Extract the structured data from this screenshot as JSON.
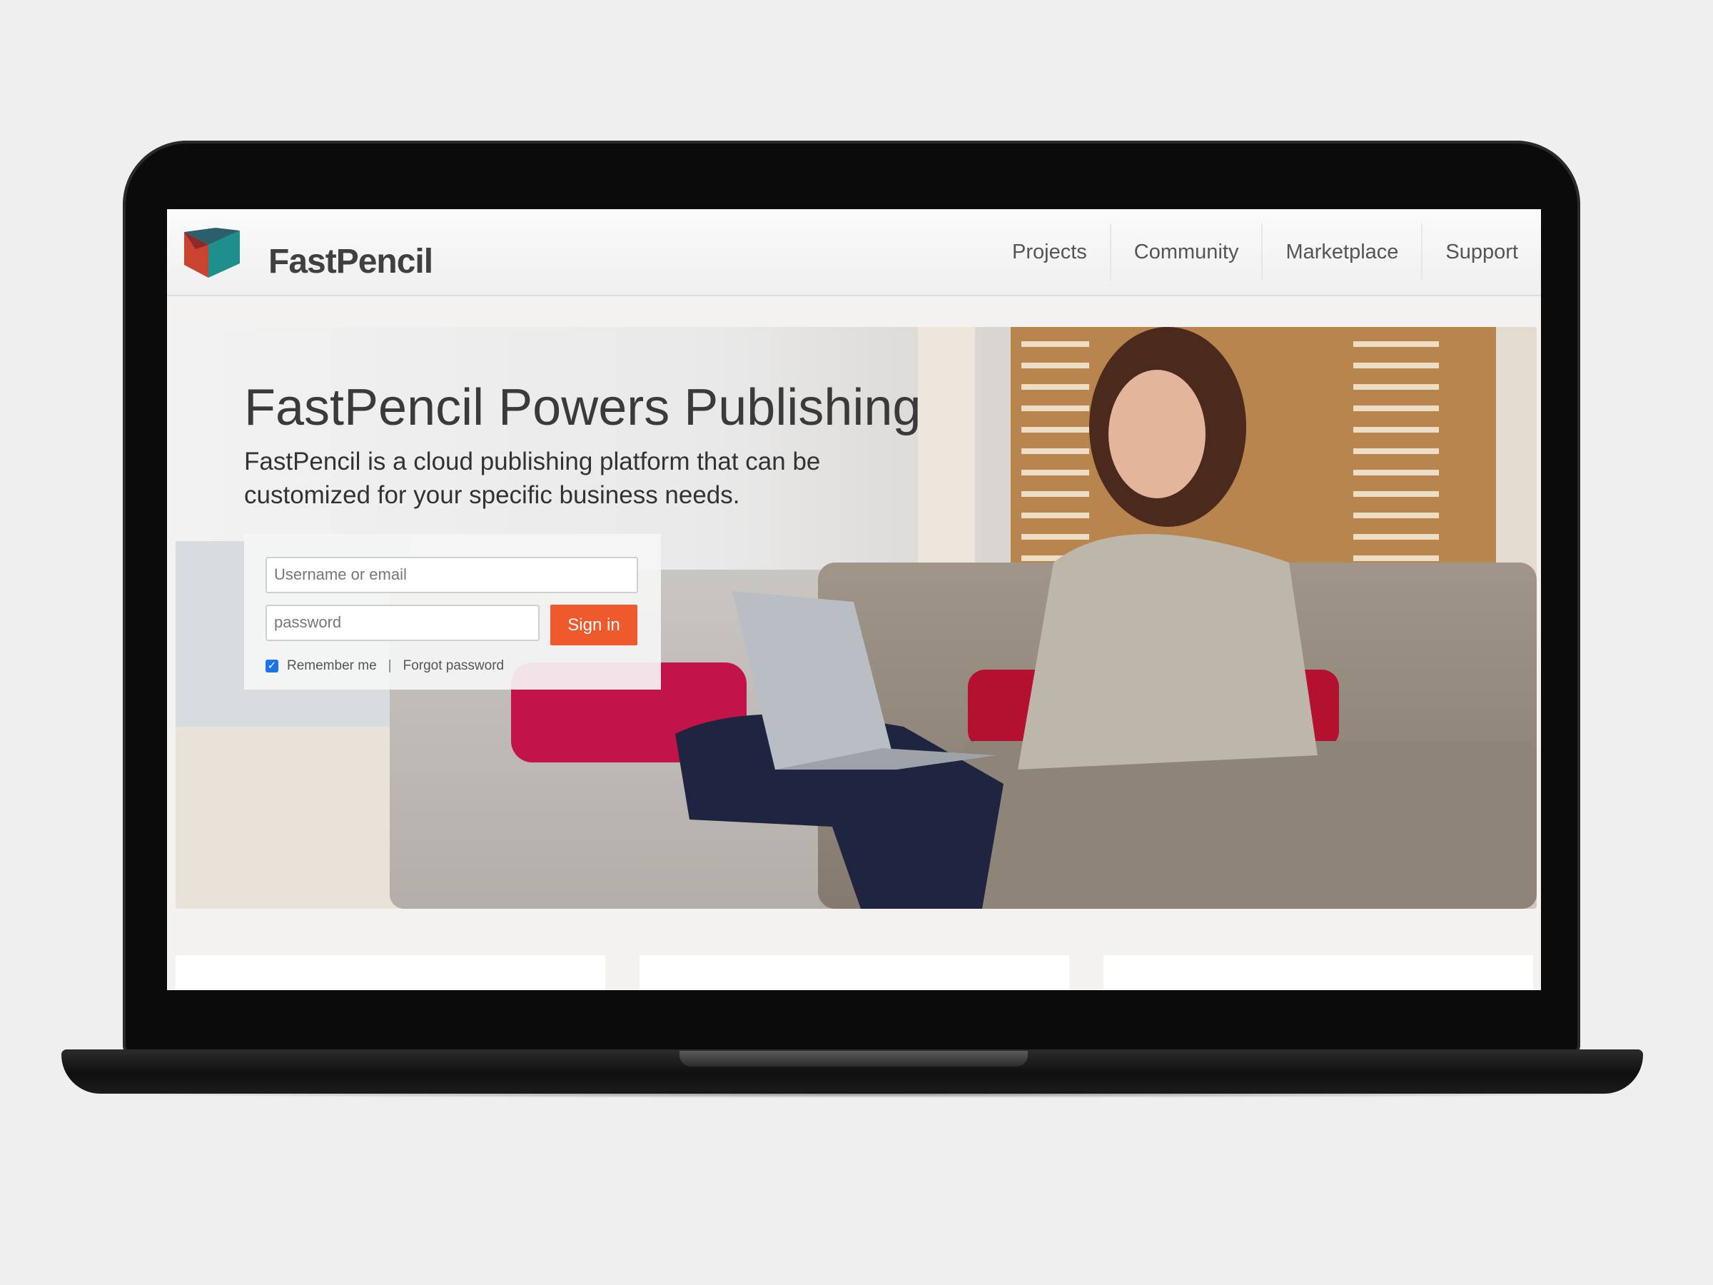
{
  "brand": {
    "name": "FastPencil",
    "logo_colors": [
      "#c9432f",
      "#1e8f8a",
      "#2f2f2f"
    ]
  },
  "nav": {
    "items": [
      "Projects",
      "Community",
      "Marketplace",
      "Support"
    ]
  },
  "hero": {
    "title": "FastPencil Powers Publishing",
    "subtitle": "FastPencil is a cloud publishing platform that can be customized for your specific business needs."
  },
  "login": {
    "username_placeholder": "Username or email",
    "password_placeholder": "password",
    "signin_label": "Sign in",
    "remember_label": "Remember me",
    "remember_checked": true,
    "separator": "|",
    "forgot_label": "Forgot password"
  },
  "colors": {
    "accent": "#ee5a2c",
    "checkbox": "#1a73e8"
  }
}
